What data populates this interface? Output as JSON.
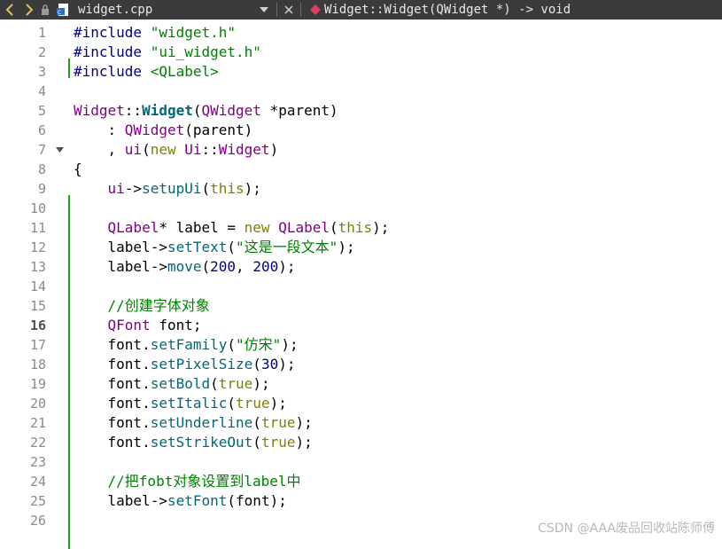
{
  "toolbar": {
    "file_name": "widget.cpp",
    "symbol": "Widget::Widget(QWidget *) -> void"
  },
  "editor": {
    "current_line": 16,
    "lines": [
      {
        "n": "1",
        "tokens": [
          {
            "t": "#include ",
            "c": "pp"
          },
          {
            "t": "\"widget.h\"",
            "c": "str"
          }
        ]
      },
      {
        "n": "2",
        "tokens": [
          {
            "t": "#include ",
            "c": "pp"
          },
          {
            "t": "\"ui_widget.h\"",
            "c": "str"
          }
        ]
      },
      {
        "n": "3",
        "tokens": [
          {
            "t": "#include ",
            "c": "pp"
          },
          {
            "t": "<QLabel>",
            "c": "str"
          }
        ]
      },
      {
        "n": "4",
        "tokens": []
      },
      {
        "n": "5",
        "tokens": [
          {
            "t": "Widget",
            "c": "typ"
          },
          {
            "t": "::",
            "c": "plain"
          },
          {
            "t": "Widget",
            "c": "fnb"
          },
          {
            "t": "(",
            "c": "plain"
          },
          {
            "t": "QWidget",
            "c": "typ"
          },
          {
            "t": " *parent)",
            "c": "plain"
          }
        ]
      },
      {
        "n": "6",
        "tokens": [
          {
            "t": "    : ",
            "c": "plain"
          },
          {
            "t": "QWidget",
            "c": "typ"
          },
          {
            "t": "(parent)",
            "c": "plain"
          }
        ]
      },
      {
        "n": "7",
        "tokens": [
          {
            "t": "    , ",
            "c": "plain"
          },
          {
            "t": "ui",
            "c": "typ"
          },
          {
            "t": "(",
            "c": "plain"
          },
          {
            "t": "new ",
            "c": "kw"
          },
          {
            "t": "Ui",
            "c": "typ"
          },
          {
            "t": "::",
            "c": "plain"
          },
          {
            "t": "Widget",
            "c": "typ"
          },
          {
            "t": ")",
            "c": "plain"
          }
        ],
        "fold": true
      },
      {
        "n": "8",
        "tokens": [
          {
            "t": "{",
            "c": "plain"
          }
        ]
      },
      {
        "n": "9",
        "tokens": [
          {
            "t": "    ",
            "c": "plain"
          },
          {
            "t": "ui",
            "c": "typ"
          },
          {
            "t": "->",
            "c": "plain"
          },
          {
            "t": "setupUi",
            "c": "fn"
          },
          {
            "t": "(",
            "c": "plain"
          },
          {
            "t": "this",
            "c": "kw"
          },
          {
            "t": ");",
            "c": "plain"
          }
        ]
      },
      {
        "n": "10",
        "tokens": []
      },
      {
        "n": "11",
        "tokens": [
          {
            "t": "    ",
            "c": "plain"
          },
          {
            "t": "QLabel",
            "c": "typ"
          },
          {
            "t": "* label = ",
            "c": "plain"
          },
          {
            "t": "new ",
            "c": "kw"
          },
          {
            "t": "QLabel",
            "c": "typ"
          },
          {
            "t": "(",
            "c": "plain"
          },
          {
            "t": "this",
            "c": "kw"
          },
          {
            "t": ");",
            "c": "plain"
          }
        ]
      },
      {
        "n": "12",
        "tokens": [
          {
            "t": "    label->",
            "c": "plain"
          },
          {
            "t": "setText",
            "c": "fn"
          },
          {
            "t": "(",
            "c": "plain"
          },
          {
            "t": "\"这是一段文本\"",
            "c": "str"
          },
          {
            "t": ");",
            "c": "plain"
          }
        ]
      },
      {
        "n": "13",
        "tokens": [
          {
            "t": "    label->",
            "c": "plain"
          },
          {
            "t": "move",
            "c": "fn"
          },
          {
            "t": "(",
            "c": "plain"
          },
          {
            "t": "200",
            "c": "num"
          },
          {
            "t": ", ",
            "c": "plain"
          },
          {
            "t": "200",
            "c": "num"
          },
          {
            "t": ");",
            "c": "plain"
          }
        ]
      },
      {
        "n": "14",
        "tokens": []
      },
      {
        "n": "15",
        "tokens": [
          {
            "t": "    //创建字体对象",
            "c": "cm"
          }
        ]
      },
      {
        "n": "16",
        "tokens": [
          {
            "t": "    ",
            "c": "plain"
          },
          {
            "t": "QFont",
            "c": "typ"
          },
          {
            "t": " font;",
            "c": "plain"
          }
        ]
      },
      {
        "n": "17",
        "tokens": [
          {
            "t": "    font.",
            "c": "plain"
          },
          {
            "t": "setFamily",
            "c": "fn"
          },
          {
            "t": "(",
            "c": "plain"
          },
          {
            "t": "\"仿宋\"",
            "c": "str"
          },
          {
            "t": ");",
            "c": "plain"
          }
        ]
      },
      {
        "n": "18",
        "tokens": [
          {
            "t": "    font.",
            "c": "plain"
          },
          {
            "t": "setPixelSize",
            "c": "fn"
          },
          {
            "t": "(",
            "c": "plain"
          },
          {
            "t": "30",
            "c": "num"
          },
          {
            "t": ");",
            "c": "plain"
          }
        ]
      },
      {
        "n": "19",
        "tokens": [
          {
            "t": "    font.",
            "c": "plain"
          },
          {
            "t": "setBold",
            "c": "fn"
          },
          {
            "t": "(",
            "c": "plain"
          },
          {
            "t": "true",
            "c": "kw"
          },
          {
            "t": ");",
            "c": "plain"
          }
        ]
      },
      {
        "n": "20",
        "tokens": [
          {
            "t": "    font.",
            "c": "plain"
          },
          {
            "t": "setItalic",
            "c": "fn"
          },
          {
            "t": "(",
            "c": "plain"
          },
          {
            "t": "true",
            "c": "kw"
          },
          {
            "t": ");",
            "c": "plain"
          }
        ]
      },
      {
        "n": "21",
        "tokens": [
          {
            "t": "    font.",
            "c": "plain"
          },
          {
            "t": "setUnderline",
            "c": "fn"
          },
          {
            "t": "(",
            "c": "plain"
          },
          {
            "t": "true",
            "c": "kw"
          },
          {
            "t": ");",
            "c": "plain"
          }
        ]
      },
      {
        "n": "22",
        "tokens": [
          {
            "t": "    font.",
            "c": "plain"
          },
          {
            "t": "setStrikeOut",
            "c": "fn"
          },
          {
            "t": "(",
            "c": "plain"
          },
          {
            "t": "true",
            "c": "kw"
          },
          {
            "t": ");",
            "c": "plain"
          }
        ]
      },
      {
        "n": "23",
        "tokens": []
      },
      {
        "n": "24",
        "tokens": [
          {
            "t": "    //把fobt对象设置到label中",
            "c": "cm"
          }
        ]
      },
      {
        "n": "25",
        "tokens": [
          {
            "t": "    label->",
            "c": "plain"
          },
          {
            "t": "setFont",
            "c": "fn"
          },
          {
            "t": "(font);",
            "c": "plain"
          }
        ]
      },
      {
        "n": "26",
        "tokens": []
      }
    ]
  },
  "watermark": "CSDN @AAA废品回收站陈师傅"
}
